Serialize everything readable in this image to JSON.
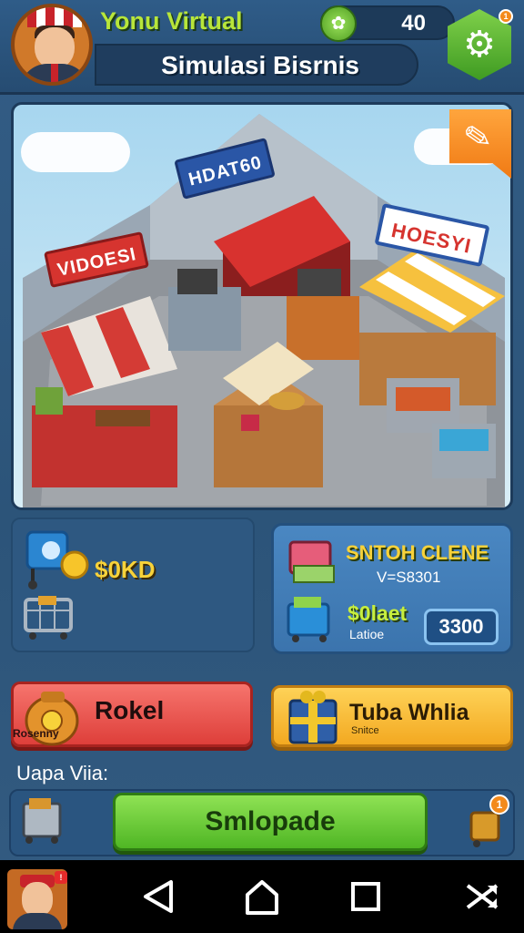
{
  "header": {
    "player_name": "Yonu Virtual",
    "title": "Simulasi Bisrnis",
    "coins": "40",
    "settings_badge": "1"
  },
  "scene": {
    "sign_left": "VIDOESI",
    "sign_center": "HDAT60",
    "sign_right": "HOESYI"
  },
  "stats": {
    "cash": "$0KD",
    "title": "SNTOH CLENE",
    "subtitle": "V=S8301",
    "value": "$0laet",
    "caption": "Latioe",
    "box_value": "3300"
  },
  "actions": {
    "left_label": "Rokel",
    "left_sub": "Rosenny",
    "right_label": "Tuba Whlia",
    "right_sub": "Snitce"
  },
  "section_label": "Uapa Viia:",
  "main_button": "Smlopade",
  "bottom_badge": "1",
  "colors": {
    "accent_green": "#4fb624",
    "accent_red": "#de3f3a",
    "accent_yellow": "#f3a921",
    "panel_blue": "#3b74ad"
  },
  "icons": [
    "coin-leaf-icon",
    "gear-icon",
    "pencil-icon",
    "back-icon",
    "home-icon",
    "recents-icon",
    "shuffle-icon"
  ]
}
